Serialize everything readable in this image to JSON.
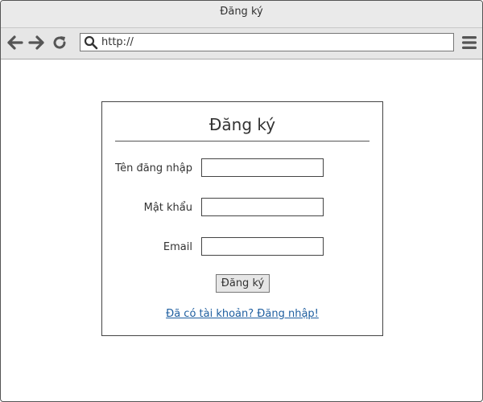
{
  "window": {
    "title": "Đăng ký"
  },
  "toolbar": {
    "back_icon": "arrow-left-icon",
    "forward_icon": "arrow-right-icon",
    "reload_icon": "reload-icon",
    "search_icon": "search-icon",
    "menu_icon": "hamburger-menu-icon",
    "url": "http://"
  },
  "form": {
    "title": "Đăng ký",
    "fields": [
      {
        "label": "Tên đăng nhập",
        "value": ""
      },
      {
        "label": "Mật khẩu",
        "value": ""
      },
      {
        "label": "Email",
        "value": ""
      }
    ],
    "submit_label": "Đăng ký",
    "login_link": "Đã có tài khoản? Đăng nhập!"
  },
  "colors": {
    "link": "#1f5fa0",
    "icon": "#555555",
    "titlebar_bg": "#eaeaea",
    "button_bg": "#e6e6e6"
  }
}
